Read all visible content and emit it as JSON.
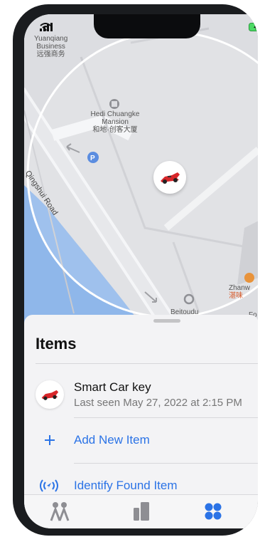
{
  "map": {
    "labels": {
      "business_en1": "Yuanqiang",
      "business_en2": "Business",
      "business_cn": "远强商务",
      "mansion_en1": "Hedi Chuangke",
      "mansion_en2": "Mansion",
      "mansion_cn": "和地·创客大厦",
      "road": "Qingshui Road",
      "poi_right": "Zhanw",
      "poi_right_cn": "湛味",
      "bottom_label": "Beitoudu",
      "bottom_right": "Fo"
    },
    "pin_icon": "race-car-icon"
  },
  "sheet": {
    "title": "Items",
    "item": {
      "name": "Smart Car key",
      "last_seen": "Last seen May 27, 2022 at 2:15 PM"
    },
    "actions": [
      {
        "icon": "plus-icon",
        "label": "Add New Item"
      },
      {
        "icon": "identify-signal-icon",
        "label": "Identify Found Item"
      }
    ]
  },
  "tabbar": {
    "tabs": [
      "people-icon",
      "devices-icon",
      "items-icon"
    ],
    "active_color": "#2b73e6"
  },
  "colors": {
    "accent": "#2b73e6",
    "water": "#8fb7ea",
    "map": "#dcdde1"
  }
}
